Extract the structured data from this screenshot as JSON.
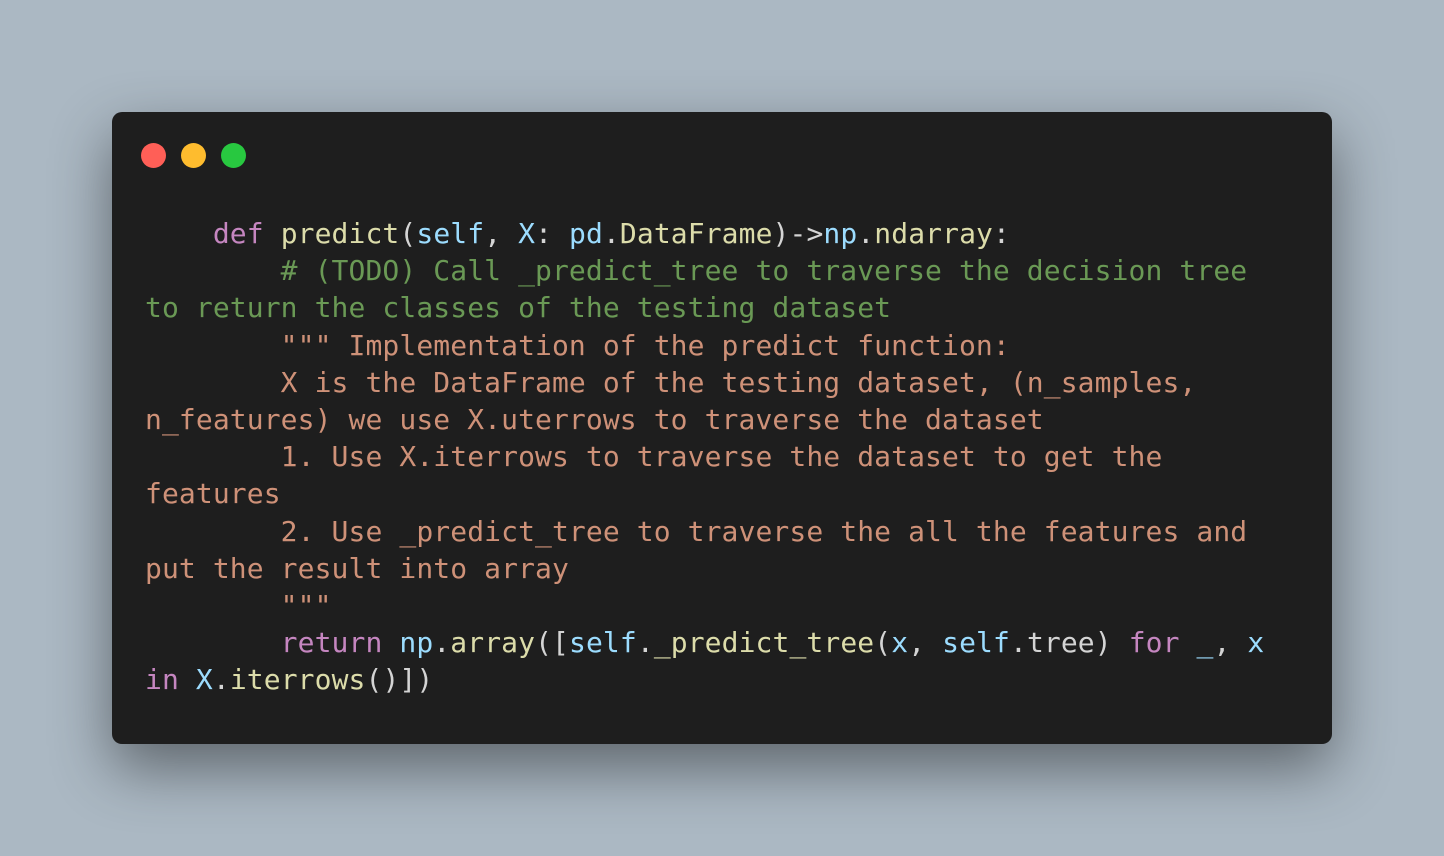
{
  "window": {
    "buttons": {
      "close_color": "#ff5f57",
      "minimize_color": "#febc2e",
      "maximize_color": "#28c840"
    }
  },
  "code": {
    "line1": {
      "indent": "    ",
      "kw_def": "def",
      "fn_name": "predict",
      "open_paren": "(",
      "self": "self",
      "comma": ", ",
      "param": "X",
      "colon": ": ",
      "pd": "pd",
      "dot1": ".",
      "dataframe": "DataFrame",
      "close_arrow": ")->",
      "np": "np",
      "dot2": ".",
      "ndarray": "ndarray",
      "end_colon": ":"
    },
    "comment_line1": "        # (TODO) Call _predict_tree to traverse the decision tree",
    "comment_line2": "to return the classes of the testing dataset",
    "doc_lines": [
      "        \"\"\" Implementation of the predict function:",
      "        X is the DataFrame of the testing dataset, (n_samples,",
      "n_features) we use X.uterrows to traverse the dataset",
      "        1. Use X.iterrows to traverse the dataset to get the",
      "features",
      "        2. Use _predict_tree to traverse the all the features and",
      "put the result into array",
      "        \"\"\""
    ],
    "return_line": {
      "indent": "        ",
      "kw_return": "return",
      "np": "np",
      "dot1": ".",
      "array": "array",
      "open": "([",
      "self1": "self",
      "dot2": ".",
      "predict_tree": "_predict_tree",
      "paren_open": "(",
      "x1": "x",
      "comma1": ", ",
      "self2": "self",
      "dot3": ".",
      "tree": "tree",
      "paren_close": ") ",
      "kw_for": "for",
      "underscore": " _",
      "comma2": ", ",
      "x2": "x",
      "kw_in": "in",
      "X": "X",
      "dot4": ".",
      "iterrows": "iterrows",
      "close": "()])"
    }
  }
}
